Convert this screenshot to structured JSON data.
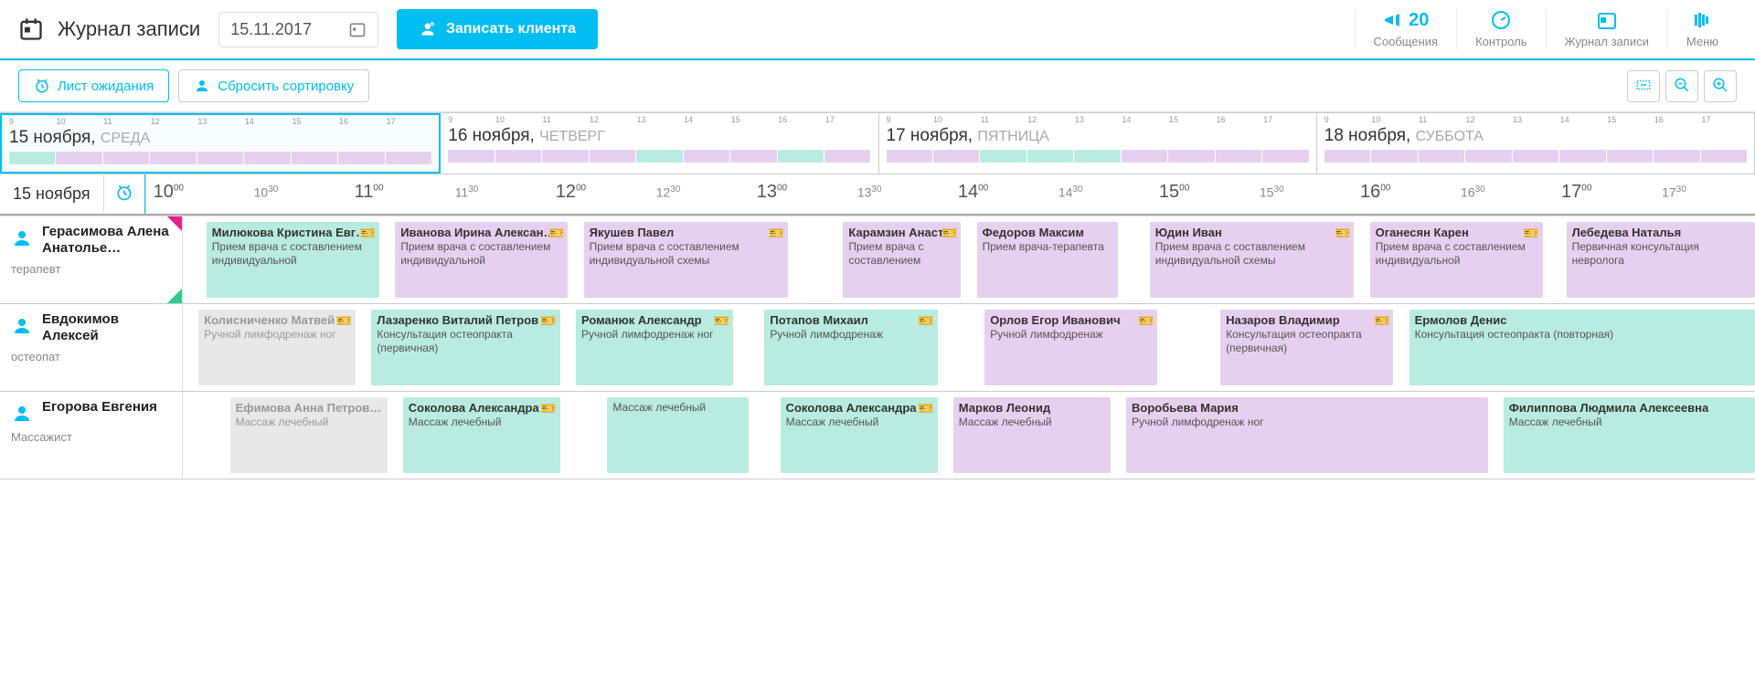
{
  "header": {
    "title": "Журнал записи",
    "date": "15.11.2017",
    "enroll": "Записать клиента"
  },
  "header_nav": {
    "messages_count": "20",
    "messages": "Сообщения",
    "control": "Контроль",
    "journal": "Журнал записи",
    "menu": "Меню"
  },
  "toolbar": {
    "waitlist": "Лист ожидания",
    "reset_sort": "Сбросить сортировку"
  },
  "days": [
    {
      "date": "15 ноября,",
      "weekday": "СРЕДА"
    },
    {
      "date": "16 ноября,",
      "weekday": "ЧЕТВЕРГ"
    },
    {
      "date": "17 ноября,",
      "weekday": "ПЯТНИЦА"
    },
    {
      "date": "18 ноября,",
      "weekday": "СУББОТА"
    }
  ],
  "minimap_hours": [
    "9",
    "10",
    "11",
    "12",
    "13",
    "14",
    "15",
    "16",
    "17"
  ],
  "time_header_date": "15 ноября",
  "time_slots": [
    {
      "label": "10",
      "sup": "00",
      "half": false
    },
    {
      "label": "10",
      "sup": "30",
      "half": true
    },
    {
      "label": "11",
      "sup": "00",
      "half": false
    },
    {
      "label": "11",
      "sup": "30",
      "half": true
    },
    {
      "label": "12",
      "sup": "00",
      "half": false
    },
    {
      "label": "12",
      "sup": "30",
      "half": true
    },
    {
      "label": "13",
      "sup": "00",
      "half": false
    },
    {
      "label": "13",
      "sup": "30",
      "half": true
    },
    {
      "label": "14",
      "sup": "00",
      "half": false
    },
    {
      "label": "14",
      "sup": "30",
      "half": true
    },
    {
      "label": "15",
      "sup": "00",
      "half": false
    },
    {
      "label": "15",
      "sup": "30",
      "half": true
    },
    {
      "label": "16",
      "sup": "00",
      "half": false
    },
    {
      "label": "16",
      "sup": "30",
      "half": true
    },
    {
      "label": "17",
      "sup": "00",
      "half": false
    },
    {
      "label": "17",
      "sup": "30",
      "half": true
    }
  ],
  "staff": [
    {
      "name": "Герасимова Алена Анатолье…",
      "role": "терапевт",
      "appts": [
        {
          "title": "Милюкова Кристина Евгеньевн",
          "desc": "Прием врача с составлением индивидуальной",
          "color": "c-teal",
          "ticket": true,
          "start": 1.5,
          "len": 11
        },
        {
          "title": "Иванова Ирина Александровн",
          "desc": "Прием врача с составлением индивидуальной",
          "color": "c-purple",
          "ticket": true,
          "start": 13.5,
          "len": 11
        },
        {
          "title": "Якушев Павел",
          "desc": "Прием врача с составлением индивидуальной схемы",
          "color": "c-purple",
          "ticket": true,
          "start": 25.5,
          "len": 13
        },
        {
          "title": "Карамзин Анастасия",
          "desc": "Прием врача с составлением",
          "color": "c-purple",
          "ticket": true,
          "start": 42,
          "len": 7.5
        },
        {
          "title": "Федоров Максим",
          "desc": "Прием врача-терапевта",
          "color": "c-purple",
          "ticket": false,
          "start": 50.5,
          "len": 9
        },
        {
          "title": "Юдин Иван",
          "desc": "Прием врача с составлением индивидуальной схемы",
          "color": "c-purple",
          "ticket": true,
          "start": 61.5,
          "len": 13
        },
        {
          "title": "Оганесян Карен",
          "desc": "Прием врача с составлением индивидуальной",
          "color": "c-purple",
          "ticket": true,
          "start": 75.5,
          "len": 11
        },
        {
          "title": "Лебедева Наталья",
          "desc": "Первичная консультация невролога",
          "color": "c-purple",
          "ticket": false,
          "start": 88,
          "len": 12
        }
      ]
    },
    {
      "name": "Евдокимов Алексей",
      "role": "остеопат",
      "appts": [
        {
          "title": "Колисниченко Матвей",
          "desc": "Ручной лимфодренаж ног",
          "color": "c-gray",
          "ticket": true,
          "start": 1,
          "len": 10
        },
        {
          "title": "Лазаренко Виталий Петров",
          "desc": "Консультация остеопракта (первичная)",
          "color": "c-teal",
          "ticket": true,
          "start": 12,
          "len": 12
        },
        {
          "title": "Романюк Александр",
          "desc": "Ручной лимфодренаж ног",
          "color": "c-teal",
          "ticket": true,
          "start": 25,
          "len": 10
        },
        {
          "title": "Потапов Михаил",
          "desc": "Ручной лимфодренаж",
          "color": "c-teal",
          "ticket": true,
          "start": 37,
          "len": 11
        },
        {
          "title": "Орлов Егор Иванович",
          "desc": "Ручной лимфодренаж",
          "color": "c-purple",
          "ticket": true,
          "start": 51,
          "len": 11
        },
        {
          "title": "Назаров Владимир",
          "desc": "Консультация остеопракта (первичная)",
          "color": "c-purple",
          "ticket": true,
          "start": 66,
          "len": 11
        },
        {
          "title": "Ермолов Денис",
          "desc": "Консультация остеопракта (повторная)",
          "color": "c-teal",
          "ticket": false,
          "start": 78,
          "len": 22
        }
      ]
    },
    {
      "name": "Егорова Евгения",
      "role": "Массажист",
      "appts": [
        {
          "title": "Ефимова Анна Петровна",
          "desc": "Массаж лечебный",
          "color": "c-gray",
          "ticket": false,
          "start": 3,
          "len": 10
        },
        {
          "title": "Соколова Александра Фе",
          "desc": "Массаж лечебный",
          "color": "c-teal",
          "ticket": true,
          "start": 14,
          "len": 10
        },
        {
          "title": "",
          "desc": "Массаж лечебный",
          "color": "c-teal",
          "ticket": false,
          "start": 27,
          "len": 9
        },
        {
          "title": "Соколова Александра Фе",
          "desc": "Массаж лечебный",
          "color": "c-teal",
          "ticket": true,
          "start": 38,
          "len": 10
        },
        {
          "title": "Марков Леонид",
          "desc": "Массаж лечебный",
          "color": "c-purple",
          "ticket": false,
          "start": 49,
          "len": 10
        },
        {
          "title": "Воробьева Мария",
          "desc": "Ручной лимфодренаж ног",
          "color": "c-purple",
          "ticket": false,
          "start": 60,
          "len": 23
        },
        {
          "title": "Филиппова Людмила Алексеевна",
          "desc": "Массаж лечебный",
          "color": "c-teal",
          "ticket": false,
          "start": 84,
          "len": 16
        }
      ]
    }
  ]
}
